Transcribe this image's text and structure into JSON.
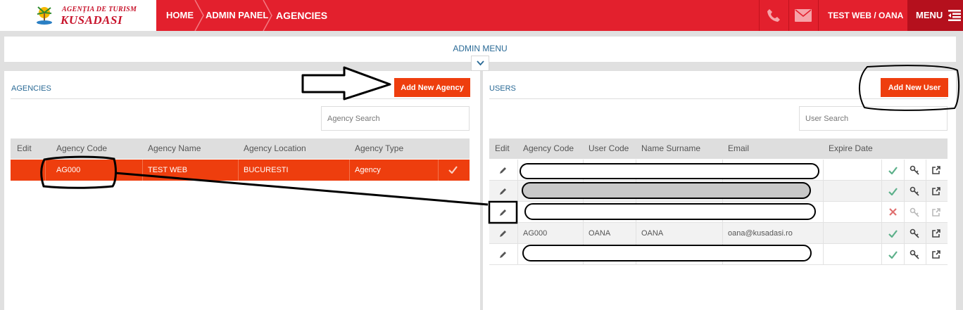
{
  "logo": {
    "line1": "AGENȚIA DE TURISM",
    "line2": "KUSADASI"
  },
  "breadcrumb": [
    "HOME",
    "ADMIN PANEL",
    "AGENCIES"
  ],
  "header": {
    "user": "TEST WEB / OANA",
    "menu_label": "MENU"
  },
  "admin_menu": {
    "title": "ADMIN MENU"
  },
  "agencies": {
    "title": "AGENCIES",
    "add_button": "Add New Agency",
    "search_placeholder": "Agency Search",
    "columns": [
      "Edit",
      "Agency Code",
      "Agency Name",
      "Agency Location",
      "Agency Type"
    ],
    "rows": [
      {
        "code": "AG000",
        "name": "TEST WEB",
        "location": "BUCURESTI",
        "type": "Agency"
      }
    ]
  },
  "users": {
    "title": "USERS",
    "add_button": "Add New User",
    "search_placeholder": "User Search",
    "columns": [
      "Edit",
      "Agency Code",
      "User Code",
      "Name Surname",
      "Email",
      "Expire Date"
    ],
    "rows": [
      {
        "agency_code": "",
        "user_code": "",
        "name": "",
        "email": "",
        "expire": "",
        "status": "active"
      },
      {
        "agency_code": "",
        "user_code": "",
        "name": "",
        "email": "",
        "expire": "",
        "status": "active"
      },
      {
        "agency_code": "",
        "user_code": "",
        "name": "",
        "email": "",
        "expire": "",
        "status": "inactive"
      },
      {
        "agency_code": "AG000",
        "user_code": "OANA",
        "name": "OANA",
        "email": "oana@kusadasi.ro",
        "expire": "",
        "status": "active"
      },
      {
        "agency_code": "",
        "user_code": "",
        "name": "",
        "email": "",
        "expire": "",
        "status": "active"
      }
    ]
  },
  "colors": {
    "header_red": "#e3202d",
    "button_orange": "#ee3e0e",
    "title_blue": "#2a6a96",
    "check_green": "#5cb08a",
    "cross_red": "#e07070"
  }
}
